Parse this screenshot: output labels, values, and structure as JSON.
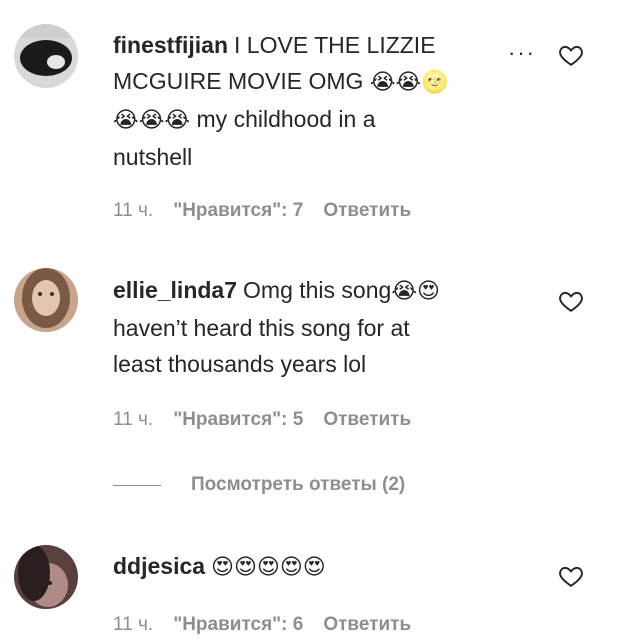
{
  "comments": [
    {
      "username": "finestfijian",
      "text": "I LOVE THE LIZZIE MCGUIRE MOVIE OMG",
      "emoji_line1": "😭😭🌝",
      "emoji_line2": "😭😭😭",
      "text_line2": "my childhood in a",
      "text_line3": "nutshell",
      "time": "11 ч.",
      "likes": "\"Нравится\": 7",
      "reply": "Ответить"
    },
    {
      "username": "ellie_linda7",
      "text_line1": "Omg this song",
      "emoji": "😭😍",
      "text_line2": "haven’t heard this song for at",
      "text_line3": "least thousands years lol",
      "time": "11 ч.",
      "likes": "\"Нравится\": 5",
      "reply": "Ответить"
    },
    {
      "username": "ddjesica",
      "emoji": "😍😍😍😍😍",
      "time": "11 ч.",
      "likes": "\"Нравится\": 6",
      "reply": "Ответить"
    }
  ],
  "view_replies": "Посмотреть ответы (2)",
  "more_options": "···"
}
